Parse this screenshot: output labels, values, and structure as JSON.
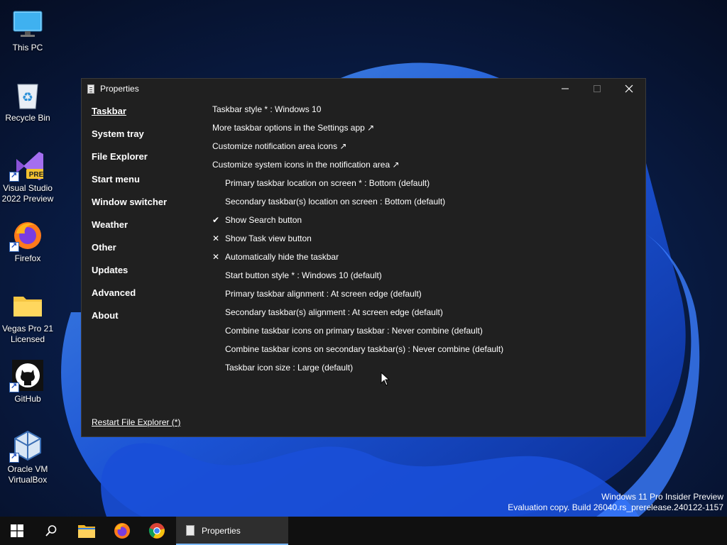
{
  "desktop": {
    "icons": [
      {
        "label_1": "This PC",
        "label_2": ""
      },
      {
        "label_1": "Recycle Bin",
        "label_2": ""
      },
      {
        "label_1": "Visual Studio",
        "label_2": "2022 Preview",
        "badge": "PRE"
      },
      {
        "label_1": "Firefox",
        "label_2": ""
      },
      {
        "label_1": "Vegas Pro 21",
        "label_2": "Licensed"
      },
      {
        "label_1": "GitHub",
        "label_2": ""
      },
      {
        "label_1": "Oracle VM",
        "label_2": "VirtualBox"
      }
    ]
  },
  "window": {
    "title": "Properties",
    "nav": [
      "Taskbar",
      "System tray",
      "File Explorer",
      "Start menu",
      "Window switcher",
      "Weather",
      "Other",
      "Updates",
      "Advanced",
      "About"
    ],
    "active_nav": "Taskbar",
    "options": [
      {
        "text": "Taskbar style * : Windows 10",
        "mark": ""
      },
      {
        "text": "More taskbar options in the Settings app ↗",
        "mark": ""
      },
      {
        "text": "Customize notification area icons ↗",
        "mark": ""
      },
      {
        "text": "Customize system icons in the notification area ↗",
        "mark": ""
      },
      {
        "text": "Primary taskbar location on screen * : Bottom (default)",
        "mark": ""
      },
      {
        "text": "Secondary taskbar(s) location on screen : Bottom (default)",
        "mark": ""
      },
      {
        "text": "Show Search button",
        "mark": "✔"
      },
      {
        "text": "Show Task view button",
        "mark": "✕"
      },
      {
        "text": "Automatically hide the taskbar",
        "mark": "✕"
      },
      {
        "text": "Start button style * : Windows 10 (default)",
        "mark": ""
      },
      {
        "text": "Primary taskbar alignment : At screen edge (default)",
        "mark": ""
      },
      {
        "text": "Secondary taskbar(s) alignment : At screen edge (default)",
        "mark": ""
      },
      {
        "text": "Combine taskbar icons on primary taskbar : Never combine (default)",
        "mark": ""
      },
      {
        "text": "Combine taskbar icons on secondary taskbar(s) : Never combine (default)",
        "mark": ""
      },
      {
        "text": "Taskbar icon size : Large (default)",
        "mark": ""
      }
    ],
    "restart_link": "Restart File Explorer (*)"
  },
  "watermark": {
    "line1": "Windows 11 Pro Insider Preview",
    "line2": "Evaluation copy. Build 26040.rs_prerelease.240122-1157"
  },
  "taskbar": {
    "active_app_label": "Properties"
  },
  "colors": {
    "window_bg": "#202020",
    "taskbar_bg": "#101010",
    "accent": "#7ab8ff"
  }
}
